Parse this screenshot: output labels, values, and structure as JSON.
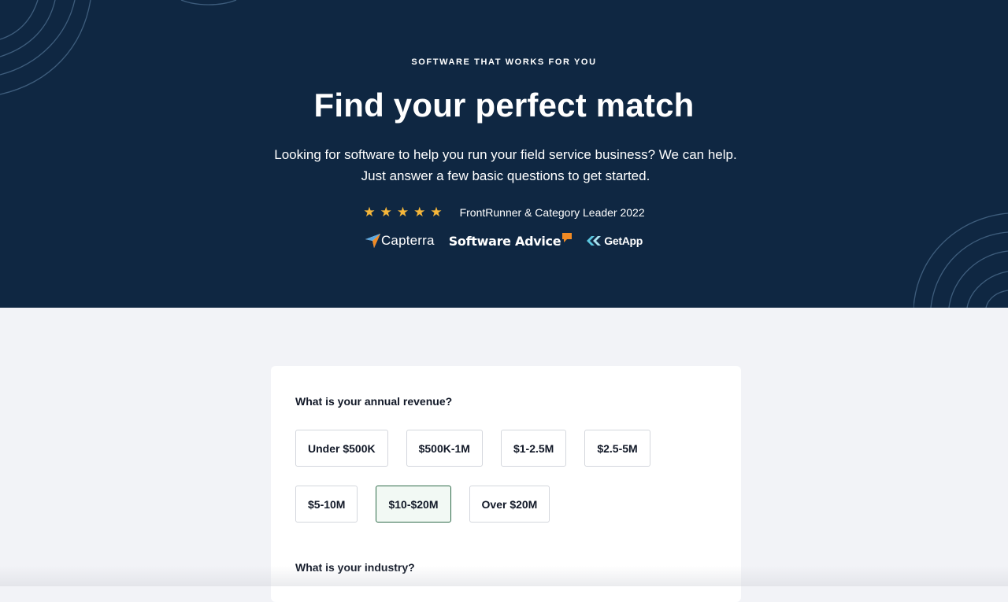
{
  "hero": {
    "eyebrow": "SOFTWARE THAT WORKS FOR YOU",
    "title": "Find your perfect match",
    "subtitle": "Looking for software to help you run your field service business? We can help. Just answer a few basic questions to get started.",
    "rating": {
      "stars": 5,
      "award_text": "FrontRunner & Category Leader 2022"
    },
    "logos": [
      {
        "name": "Capterra",
        "icon": "capterra-arrow-icon"
      },
      {
        "name": "Software Advice",
        "icon": "speech-bubble-icon"
      },
      {
        "name": "GetApp",
        "icon": "double-chevron-icon"
      }
    ],
    "colors": {
      "background": "#0f2742",
      "star": "#f5b63a",
      "sa_accent": "#f08a24",
      "getapp_accent": "#5cc8e0"
    }
  },
  "form": {
    "revenue": {
      "question": "What is your annual revenue?",
      "options": [
        "Under $500K",
        "$500K-1M",
        "$1-2.5M",
        "$2.5-5M",
        "$5-10M",
        "$10-$20M",
        "Over $20M"
      ],
      "selected": "$10-$20M"
    },
    "industry": {
      "question": "What is your industry?"
    },
    "colors": {
      "selected_border": "#2f6b4a",
      "selected_bg": "#f2f9f4"
    }
  }
}
